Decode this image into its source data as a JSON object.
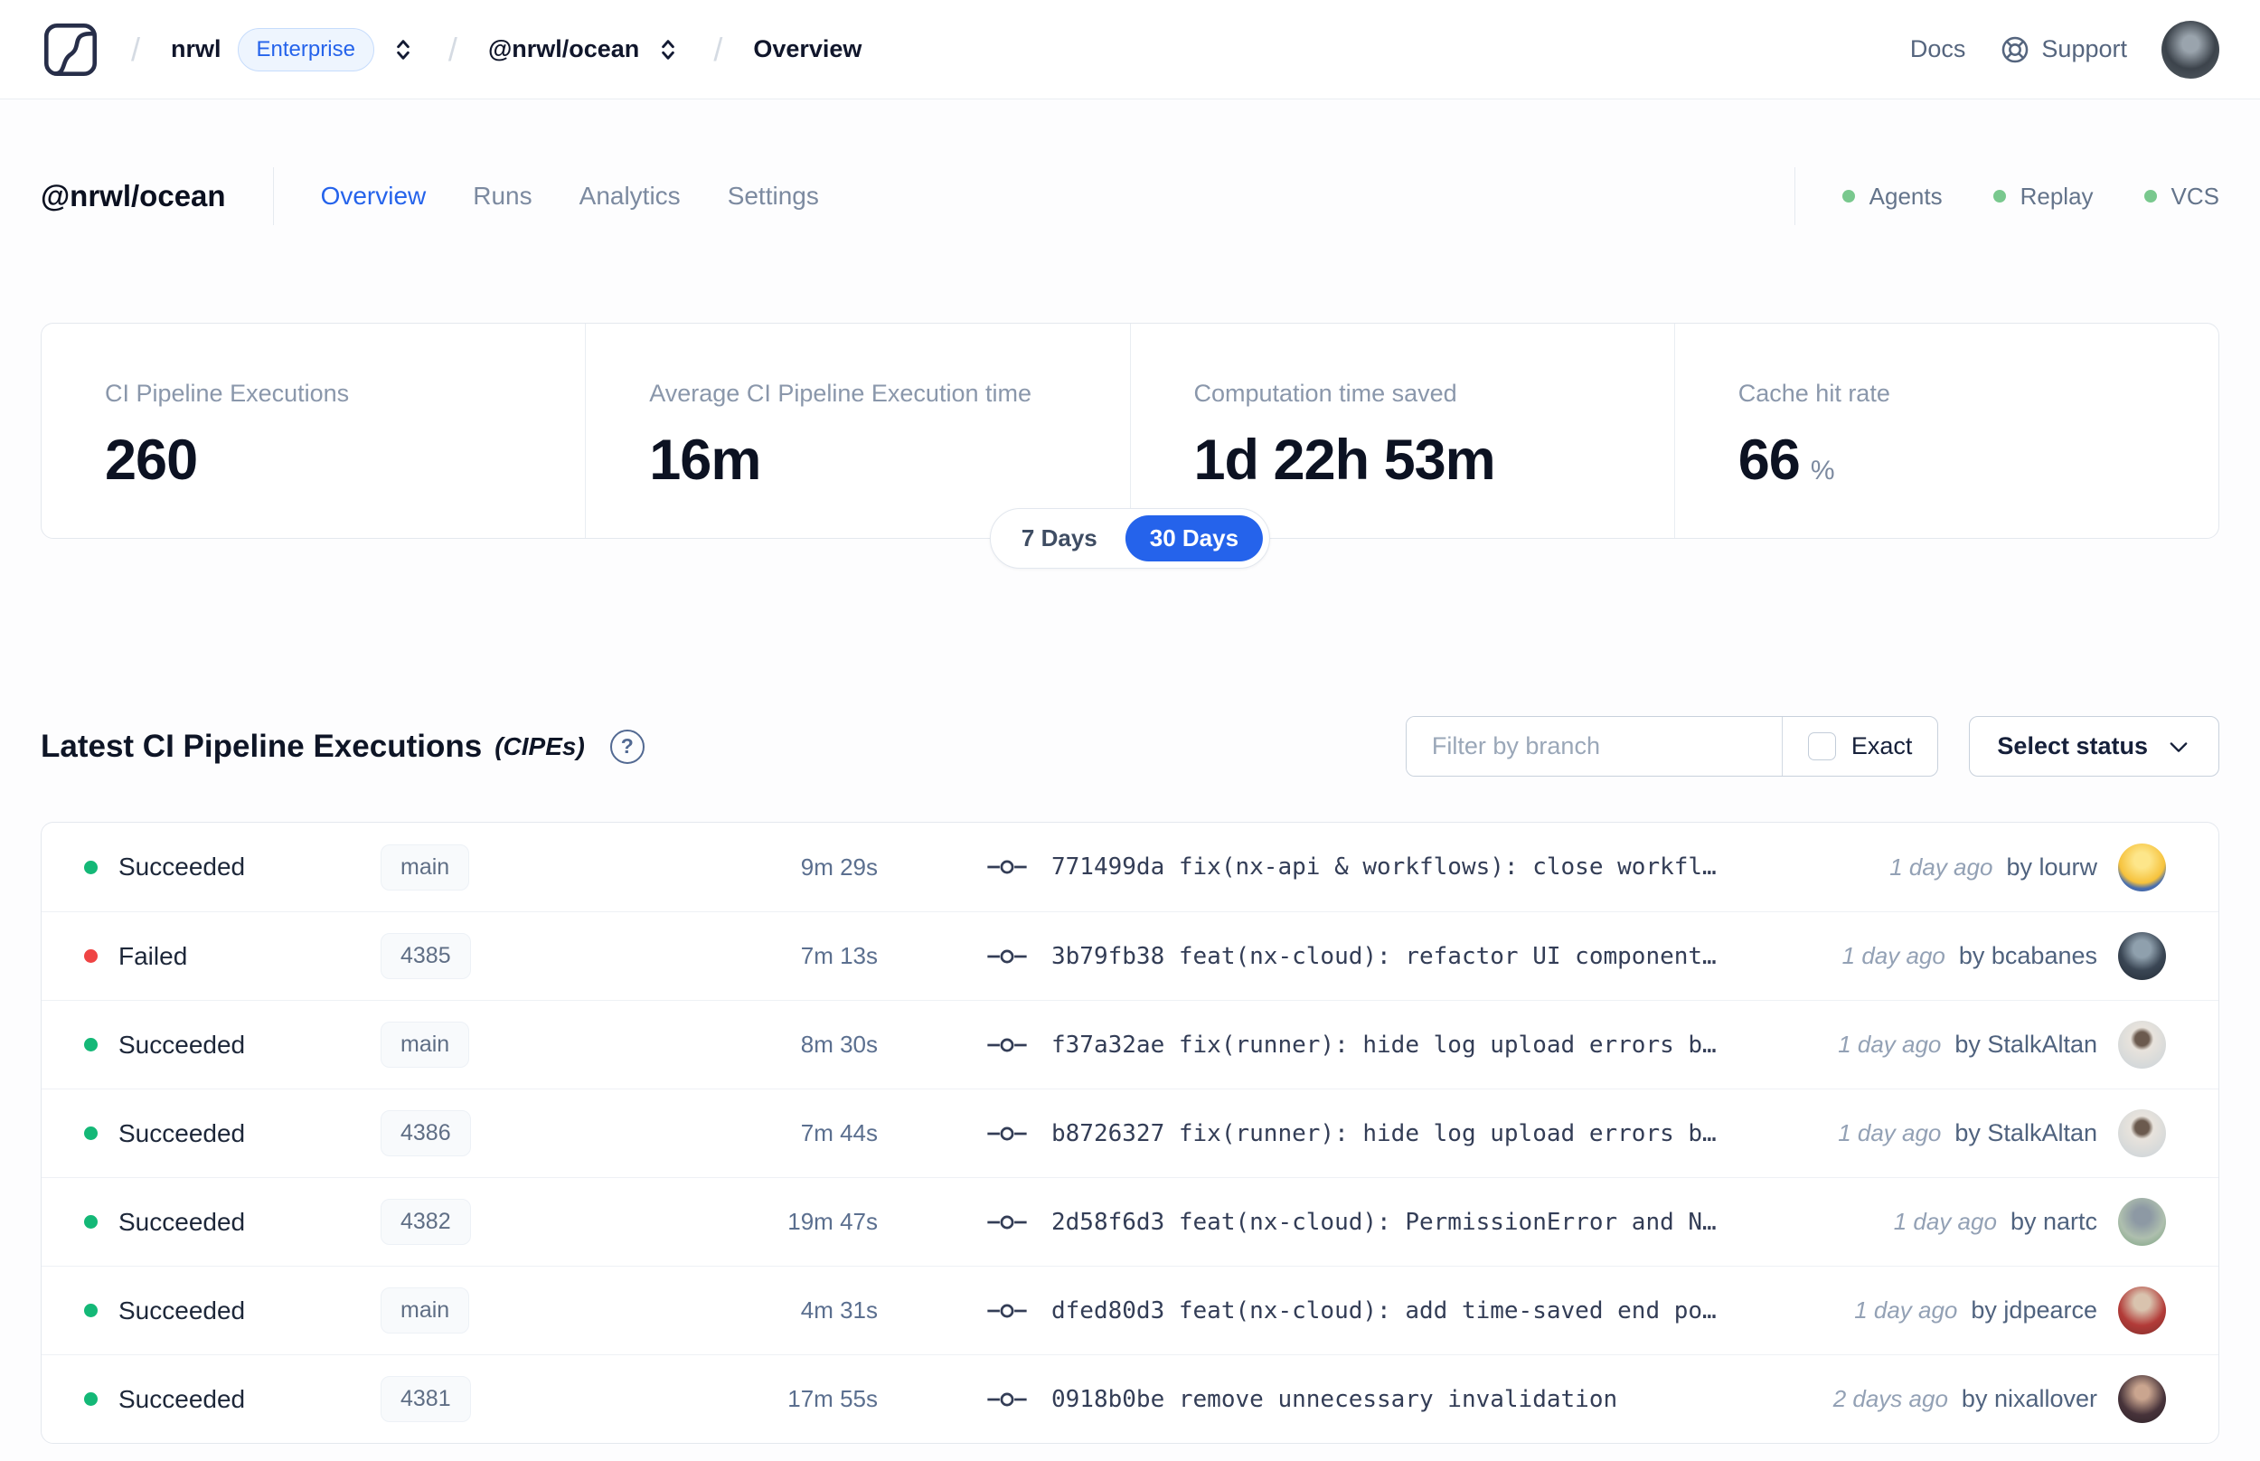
{
  "theme": {
    "accent": "#2563eb",
    "success": "#14b877",
    "danger": "#ef4444",
    "feature_dot": "#79c88e"
  },
  "topnav": {
    "logo": "nx-cloud-logo",
    "separator": "/",
    "org": "nrwl",
    "org_badge": "Enterprise",
    "workspace": "@nrwl/ocean",
    "page": "Overview",
    "docs_label": "Docs",
    "support_label": "Support",
    "user_avatar_style": "background:radial-gradient(circle at 50% 40%, #9aa4ad 0 18%, #3c434b 55%, #565f66 100%)"
  },
  "workspace_header": {
    "title": "@nrwl/ocean",
    "tabs": [
      {
        "label": "Overview",
        "active": true
      },
      {
        "label": "Runs",
        "active": false
      },
      {
        "label": "Analytics",
        "active": false
      },
      {
        "label": "Settings",
        "active": false
      }
    ],
    "features": [
      {
        "label": "Agents"
      },
      {
        "label": "Replay"
      },
      {
        "label": "VCS"
      }
    ]
  },
  "stats": {
    "cards": [
      {
        "label": "CI Pipeline Executions",
        "value": "260",
        "suffix": ""
      },
      {
        "label": "Average CI Pipeline Execution time",
        "value": "16m",
        "suffix": ""
      },
      {
        "label": "Computation time saved",
        "value": "1d 22h 53m",
        "suffix": ""
      },
      {
        "label": "Cache hit rate",
        "value": "66",
        "suffix": "%"
      }
    ],
    "range_toggle": {
      "options": [
        "7 Days",
        "30 Days"
      ],
      "active": "30 Days"
    }
  },
  "cipes": {
    "title": "Latest CI Pipeline Executions",
    "subtitle": "(CIPEs)",
    "help_icon": "?",
    "filter_placeholder": "Filter by branch",
    "exact_label": "Exact",
    "select_status_label": "Select status"
  },
  "table": {
    "rows": [
      {
        "status": "Succeeded",
        "status_kind": "succeeded",
        "branch": "main",
        "duration": "9m 29s",
        "commit": "771499da fix(nx-api & workflows): close workfl…",
        "time_ago": "1 day ago",
        "author": "by lourw",
        "avatar_style": "background:radial-gradient(circle at 50% 35%, #fde68a 0 20%, #f6c23c 58%, #4a6fae 72%, #35559c 100%)"
      },
      {
        "status": "Failed",
        "status_kind": "failed",
        "branch": "4385",
        "duration": "7m 13s",
        "commit": "3b79fb38 feat(nx-cloud): refactor UI component…",
        "time_ago": "1 day ago",
        "author": "by bcabanes",
        "avatar_style": "background:radial-gradient(circle at 50% 35%, #8fa0ad 0 22%, #3a4654 55%, #222b36 100%)"
      },
      {
        "status": "Succeeded",
        "status_kind": "succeeded",
        "branch": "main",
        "duration": "8m 30s",
        "commit": "f37a32ae fix(runner): hide log upload errors b…",
        "time_ago": "1 day ago",
        "author": "by StalkAltan",
        "avatar_style": "background:radial-gradient(circle at 50% 38%, #6b5a4e 0 18%, #e8e3dc 30%, #c9d2d8 100%)"
      },
      {
        "status": "Succeeded",
        "status_kind": "succeeded",
        "branch": "4386",
        "duration": "7m 44s",
        "commit": "b8726327 fix(runner): hide log upload errors b…",
        "time_ago": "1 day ago",
        "author": "by StalkAltan",
        "avatar_style": "background:radial-gradient(circle at 50% 38%, #6b5a4e 0 18%, #e8e3dc 30%, #c9d2d8 100%)"
      },
      {
        "status": "Succeeded",
        "status_kind": "succeeded",
        "branch": "4382",
        "duration": "19m 47s",
        "commit": "2d58f6d3 feat(nx-cloud): PermissionError and N…",
        "time_ago": "1 day ago",
        "author": "by nartc",
        "avatar_style": "background:radial-gradient(circle at 50% 38%, #8d99a4 0 22%, #aebfae 58%, #76a07b 100%)"
      },
      {
        "status": "Succeeded",
        "status_kind": "succeeded",
        "branch": "main",
        "duration": "4m 31s",
        "commit": "dfed80d3 feat(nx-cloud): add time-saved end po…",
        "time_ago": "1 day ago",
        "author": "by jdpearce",
        "avatar_style": "background:radial-gradient(circle at 50% 33%, #d9c3ae 0 20%, #b23b38 58%, #7e2f2c 100%)"
      },
      {
        "status": "Succeeded",
        "status_kind": "succeeded",
        "branch": "4381",
        "duration": "17m 55s",
        "commit": "0918b0be remove unnecessary invalidation",
        "time_ago": "2 days ago",
        "author": "by nixallover",
        "avatar_style": "background:radial-gradient(circle at 50% 36%, #caa58f 0 18%, #47333a 58%, #2d2228 100%)"
      }
    ]
  }
}
